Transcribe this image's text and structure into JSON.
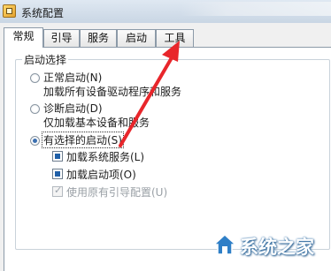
{
  "window": {
    "title": "系统配置"
  },
  "tabs": [
    {
      "label": "常规",
      "active": true
    },
    {
      "label": "引导",
      "active": false
    },
    {
      "label": "服务",
      "active": false
    },
    {
      "label": "启动",
      "active": false
    },
    {
      "label": "工具",
      "active": false
    }
  ],
  "startup_selection": {
    "group_title": "启动选择",
    "normal": {
      "label": "正常启动(N)",
      "description": "加载所有设备驱动程序和服务",
      "selected": false
    },
    "diagnostic": {
      "label": "诊断启动(D)",
      "description": "仅加载基本设备和服务",
      "selected": false
    },
    "selective": {
      "label": "有选择的启动(S)",
      "selected": true,
      "options": [
        {
          "label": "加载系统服务(L)",
          "state": "indeterminate",
          "enabled": true
        },
        {
          "label": "加载启动项(O)",
          "state": "indeterminate",
          "enabled": true
        },
        {
          "label": "使用原有引导配置(U)",
          "state": "checked",
          "enabled": false
        }
      ]
    }
  },
  "watermark": {
    "text": "系统之家"
  },
  "colors": {
    "arrow": "#e8262b",
    "accent": "#3b6fb0"
  },
  "icons": {
    "app": "msconfig-icon",
    "watermark_logo": "house-logo-icon"
  }
}
